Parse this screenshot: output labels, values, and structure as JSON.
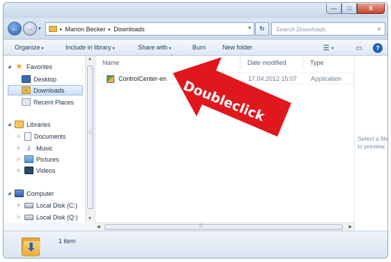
{
  "window": {
    "min_label": "—",
    "max_label": "□",
    "close_label": "X"
  },
  "address": {
    "back_icon": "←",
    "forward_icon": "→",
    "dropdown_glyph": "▾",
    "crumbs": [
      "Marion Becker",
      "Downloads"
    ],
    "crumb_sep": "▸",
    "refresh_glyph": "↻",
    "search_placeholder": "Search Downloads",
    "search_icon": "⌕"
  },
  "toolbar": {
    "organize": "Organize",
    "include": "Include in library",
    "share": "Share with",
    "burn": "Burn",
    "new_folder": "New folder",
    "caret": "▾",
    "views_icon": "☰",
    "preview_icon": "▭",
    "help_icon": "?"
  },
  "nav": {
    "favorites": "Favorites",
    "desktop": "Desktop",
    "downloads": "Downloads",
    "recent": "Recent Places",
    "libraries": "Libraries",
    "documents": "Documents",
    "music": "Music",
    "pictures": "Pictures",
    "videos": "Videos",
    "computer": "Computer",
    "disk_c": "Local Disk (C:)",
    "disk_q": "Local Disk (Q:)",
    "expanded": "◢",
    "collapsed": "▷",
    "star_glyph": "★",
    "music_glyph": "♪"
  },
  "columns": {
    "name": "Name",
    "date": "Date modified",
    "type": "Type",
    "sort_glyph": "^"
  },
  "files": [
    {
      "name": "ControlCenter-en",
      "date": "17.04.2012 15:07",
      "type": "Application"
    }
  ],
  "preview": {
    "text": "Select a file to preview."
  },
  "status": {
    "count": "1 item",
    "arrow_glyph": "⬇"
  },
  "scroll": {
    "up": "▲",
    "down": "▼",
    "left": "◀",
    "right": "▶",
    "grip_v": "≡",
    "grip_h": "|||"
  },
  "callout": {
    "text": "Doubleclick",
    "color": "#e0181e"
  }
}
